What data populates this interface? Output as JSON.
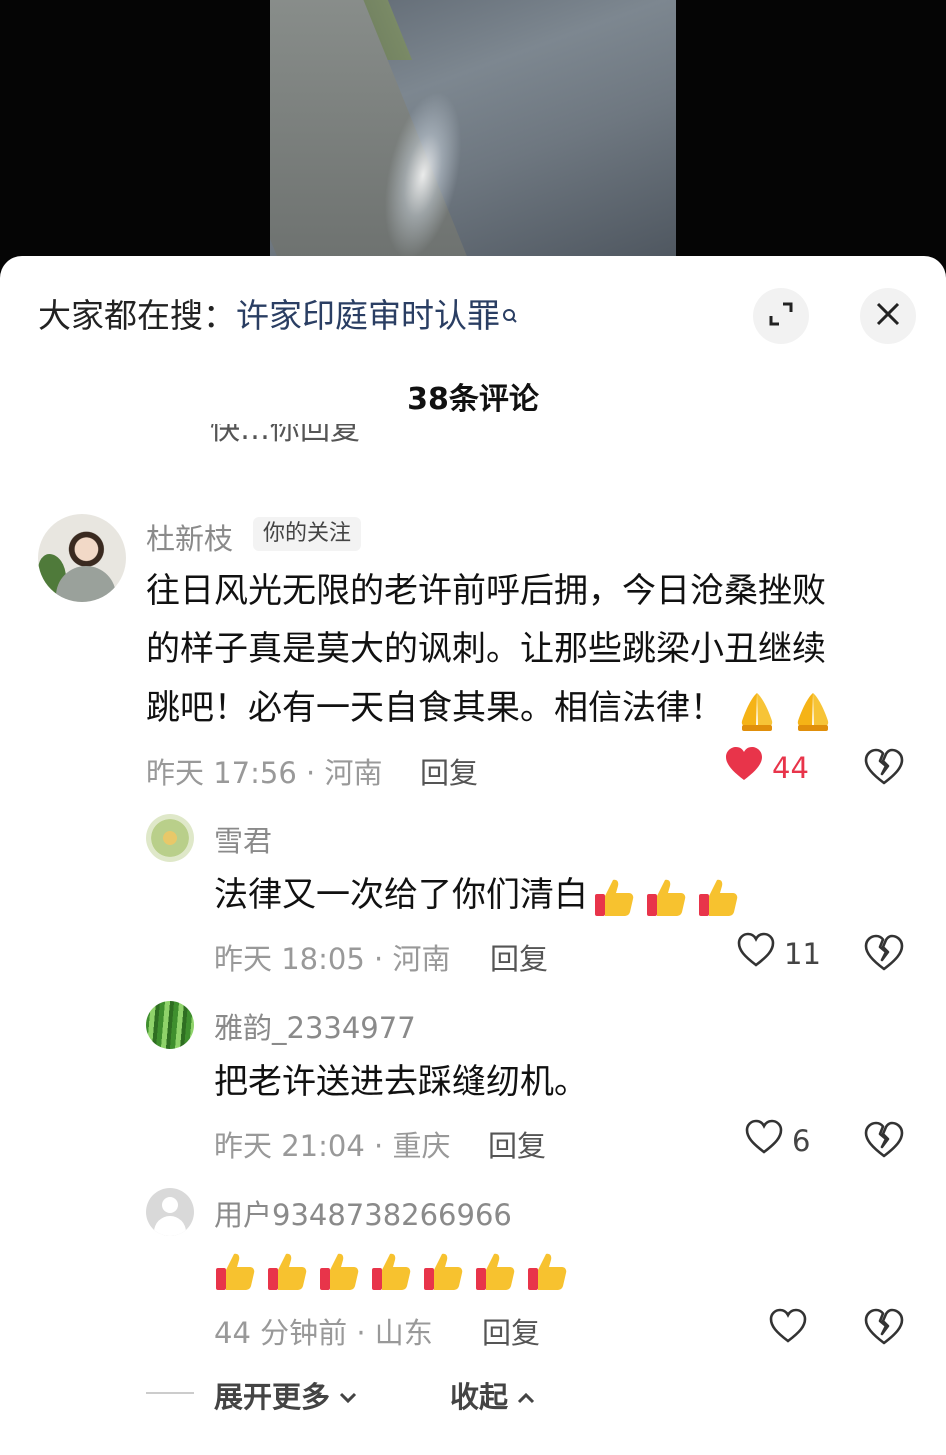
{
  "search": {
    "prefix": "大家都在搜：",
    "query": "许家印庭审时认罪"
  },
  "header": {
    "count_title": "38条评论"
  },
  "truncated_text": "快…你回复",
  "comments": [
    {
      "author": "杜新枝",
      "badge": "你的关注",
      "lines": [
        "往日风光无限的老许前呼后拥，今日沧桑挫败",
        "的样子真是莫大的讽刺。让那些跳梁小丑继续",
        "跳吧！必有一天自食其果。相信法律！"
      ],
      "meta": "昨天 17:56 · 河南",
      "reply_label": "回复",
      "likes": "44"
    },
    {
      "author": "雪君",
      "text": "法律又一次给了你们清白",
      "meta": "昨天 18:05 · 河南",
      "reply_label": "回复",
      "likes": "11"
    },
    {
      "author": "雅韵_2334977",
      "text": "把老许送进去踩缝纫机。",
      "meta": "昨天 21:04 · 重庆",
      "reply_label": "回复",
      "likes": "6"
    },
    {
      "author": "用户9348738266966",
      "meta": "44 分钟前 · 山东",
      "reply_label": "回复",
      "likes": ""
    }
  ],
  "footer": {
    "expand_label": "展开更多",
    "collapse_label": "收起"
  },
  "colors": {
    "like_active": "#e8344a",
    "search_link": "#2a3e63"
  }
}
